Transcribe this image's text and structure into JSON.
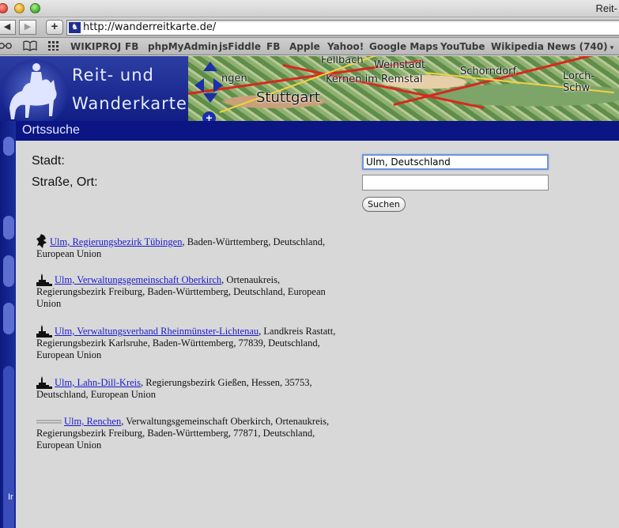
{
  "window": {
    "title": "Reit-"
  },
  "toolbar": {
    "back_glyph": "◀",
    "forward_glyph": "▶",
    "add_glyph": "+",
    "url": "http://wanderreitkarte.de/"
  },
  "bookmarks": {
    "icons": [
      "glasses-icon",
      "book-icon",
      "grid-icon"
    ],
    "items": [
      "WIKIPROJ",
      "FB",
      "phpMyAdmin",
      "jsFiddle",
      "FB",
      "Apple",
      "Yahoo!",
      "Google Maps",
      "YouTube",
      "Wikipedia",
      "News (740)"
    ]
  },
  "header": {
    "title_line1": "Reit- und",
    "title_line2": "Wanderkarte"
  },
  "map": {
    "labels": [
      "Fellbach",
      "Weinstadt",
      "Schorndorf",
      "Lorch-Schw",
      "ngen",
      "Kernen im Remstal",
      "Stuttgart"
    ]
  },
  "dialog": {
    "title": "Ortssuche",
    "label_stadt": "Stadt:",
    "label_strasse": "Straße, Ort:",
    "stadt_value": "Ulm, Deutschland",
    "strasse_value": "",
    "button_label": "Suchen"
  },
  "results": [
    {
      "icon": "region-icon",
      "link": "Ulm, Regierungsbezirk Tübingen",
      "rest": ", Baden-Württemberg, Deutschland, European Union"
    },
    {
      "icon": "town-icon",
      "link": "Ulm, Verwaltungsgemeinschaft Oberkirch",
      "rest": ", Ortenaukreis, Regierungsbezirk Freiburg, Baden-Württemberg, Deutschland, European Union"
    },
    {
      "icon": "town-icon",
      "link": "Ulm, Verwaltungsverband Rheinmünster-Lichtenau",
      "rest": ", Landkreis Rastatt, Regierungsbezirk Karlsruhe, Baden-Württemberg, 77839, Deutschland, European Union"
    },
    {
      "icon": "town-icon",
      "link": "Ulm, Lahn-Dill-Kreis",
      "rest": ", Regierungsbezirk Gießen, Hessen, 35753, Deutschland, European Union"
    },
    {
      "icon": "road-icon",
      "link": "Ulm, Renchen",
      "rest": ", Verwaltungsgemeinschaft Oberkirch, Ortenaukreis, Regierungsbezirk Freiburg, Baden-Württemberg, 77871, Deutschland, European Union"
    }
  ],
  "sidebar": {
    "partial_letter": "Ir"
  }
}
